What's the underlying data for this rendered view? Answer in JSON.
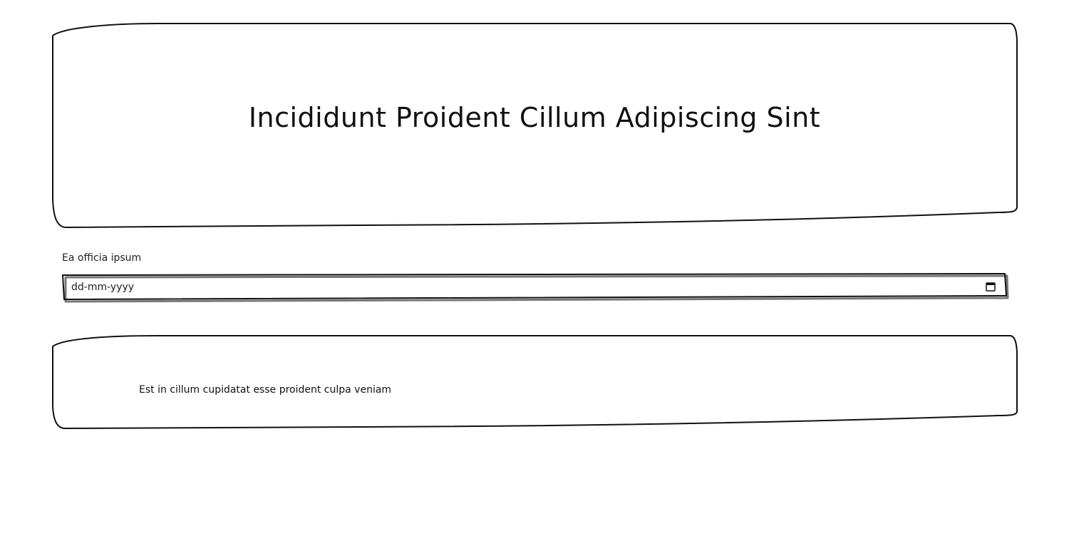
{
  "hero": {
    "title": "Incididunt Proident Cillum Adipiscing Sint"
  },
  "form": {
    "date_label": "Ea officia ipsum",
    "date_placeholder": "dd-mm-yyyy",
    "calendar_icon": "calendar-icon"
  },
  "note": {
    "text": "Est in cillum cupidatat esse proident culpa veniam"
  }
}
